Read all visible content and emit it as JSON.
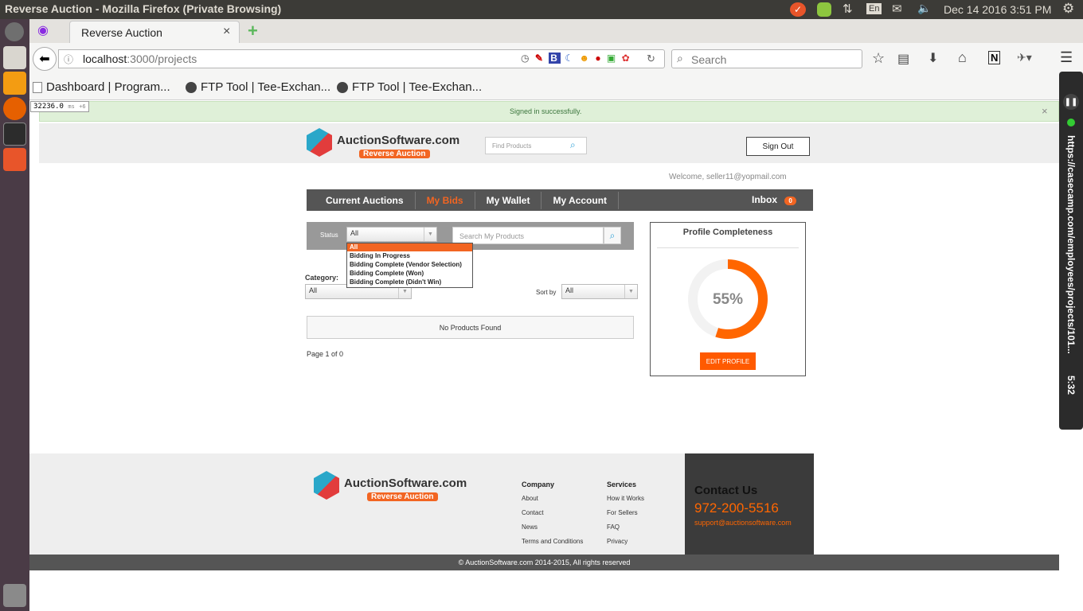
{
  "os": {
    "window_title": "Reverse Auction - Mozilla Firefox (Private Browsing)",
    "lang": "En",
    "datetime": "Dec 14 2016  3:51 PM"
  },
  "browser": {
    "tab_title": "Reverse Auction",
    "url_host": "localhost",
    "url_rest": ":3000/projects",
    "search_placeholder": "Search",
    "bookmarks": [
      "Dashboard | Program...",
      "FTP Tool | Tee-Exchan...",
      "FTP Tool | Tee-Exchan..."
    ],
    "timer_badge": "32236.0",
    "timer_unit": "ms",
    "timer_count": "+6"
  },
  "side_panel": {
    "url": "https://casecamp.com/employees/projects/101...",
    "time": "5:32"
  },
  "flash": {
    "message": "Signed in successfully.",
    "close": "×"
  },
  "header": {
    "logo_text": "AuctionSoftware.com",
    "logo_sub": "Reverse Auction",
    "find_placeholder": "Find Products",
    "sign_out": "Sign Out",
    "welcome": "Welcome, seller11@yopmail.com"
  },
  "nav": {
    "items": [
      "Current Auctions",
      "My Bids",
      "My Wallet",
      "My Account"
    ],
    "active": "My Bids",
    "inbox": "Inbox",
    "inbox_count": "0"
  },
  "filters": {
    "status_label": "Status",
    "status_value": "All",
    "status_options": [
      "All",
      "Bidding In Progress",
      "Bidding Complete (Vendor Selection)",
      "Bidding Complete (Won)",
      "Bidding Complete (Didn't Win)"
    ],
    "search_placeholder": "Search My Products",
    "category_label": "Category:",
    "category_value": "All",
    "sort_label": "Sort by",
    "sort_value": "All"
  },
  "results": {
    "empty": "No Products Found",
    "pagination": "Page 1 of 0"
  },
  "profile": {
    "title": "Profile Completeness",
    "percent": "55%",
    "percent_value": 0.55,
    "button": "EDIT PROFILE"
  },
  "footer": {
    "logo_text": "AuctionSoftware.com",
    "logo_sub": "Reverse Auction",
    "company_title": "Company",
    "company_links": [
      "About",
      "Contact",
      "News",
      "Terms and Conditions"
    ],
    "services_title": "Services",
    "services_links": [
      "How it Works",
      "For Sellers",
      "FAQ",
      "Privacy"
    ],
    "contact_title": "Contact Us",
    "phone": "972-200-5516",
    "email": "support@auctionsoftware.com",
    "copyright": "© AuctionSoftware.com 2014-2015, All rights reserved"
  },
  "colors": {
    "accent": "#f26522",
    "nav_bg": "#555555",
    "flash_bg": "#dff0d8"
  }
}
